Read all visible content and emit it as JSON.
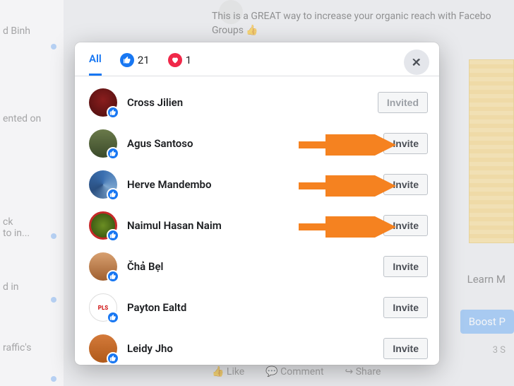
{
  "background": {
    "sidebar_snippets": [
      "d Binh",
      "ented on",
      "ck",
      "to in...",
      "d in",
      "raffic's"
    ],
    "post_text": "This is a GREAT way to increase your organic reach with Facebo\nGroups 👍",
    "learn_label": "Learn M",
    "boost_label": "Boost P",
    "meta_small": "3 S",
    "action_like": "Like",
    "action_comment": "Comment",
    "action_share": "Share"
  },
  "modal": {
    "tabs": {
      "all_label": "All",
      "like_count": "21",
      "love_count": "1"
    },
    "invite_label": "Invite",
    "invited_label": "Invited",
    "people": [
      {
        "name": "Cross Jilien",
        "status": "invited"
      },
      {
        "name": "Agus Santoso",
        "status": "invite"
      },
      {
        "name": "Herve Mandembo",
        "status": "invite"
      },
      {
        "name": "Naimul Hasan Naim",
        "status": "invite"
      },
      {
        "name": "Čhả Bẹl",
        "status": "invite"
      },
      {
        "name": "Payton Ealtd",
        "status": "invite"
      },
      {
        "name": "Leidy Jho",
        "status": "invite"
      }
    ]
  }
}
